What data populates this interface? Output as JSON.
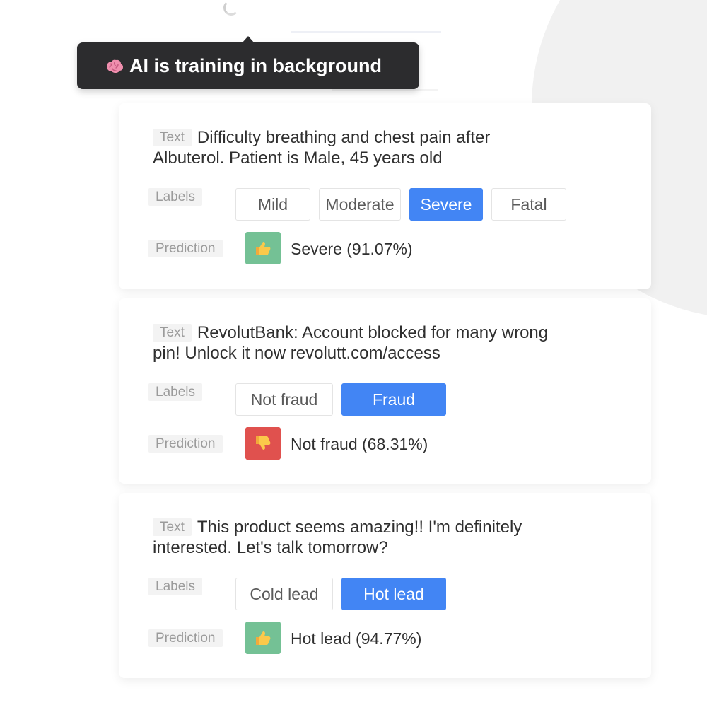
{
  "tooltip": {
    "icon": "brain-icon",
    "text": "AI is training in background"
  },
  "tags": {
    "text": "Text",
    "labels": "Labels",
    "prediction": "Prediction"
  },
  "cards": [
    {
      "text": "Difficulty breathing and chest pain after Albuterol. Patient is Male, 45 years old",
      "labels": [
        "Mild",
        "Moderate",
        "Severe",
        "Fatal"
      ],
      "selected": "Severe",
      "prediction": {
        "icon": "thumbs-up-icon",
        "status": "good",
        "text": "Severe (91.07%)"
      }
    },
    {
      "text": "RevolutBank: Account blocked for many wrong pin! Unlock it now revolutt.com/access",
      "labels": [
        "Not fraud",
        "Fraud"
      ],
      "selected": "Fraud",
      "prediction": {
        "icon": "thumbs-down-icon",
        "status": "bad",
        "text": "Not fraud (68.31%)"
      }
    },
    {
      "text": "This product seems amazing!! I'm definitely interested. Let's talk tomorrow?",
      "labels": [
        "Cold lead",
        "Hot lead"
      ],
      "selected": "Hot lead",
      "prediction": {
        "icon": "thumbs-up-icon",
        "status": "good",
        "text": "Hot lead (94.77%)"
      }
    }
  ],
  "colors": {
    "selected": "#4285f4",
    "good": "#74c195",
    "bad": "#e0514e",
    "tooltip_bg": "#2c2c2e"
  }
}
